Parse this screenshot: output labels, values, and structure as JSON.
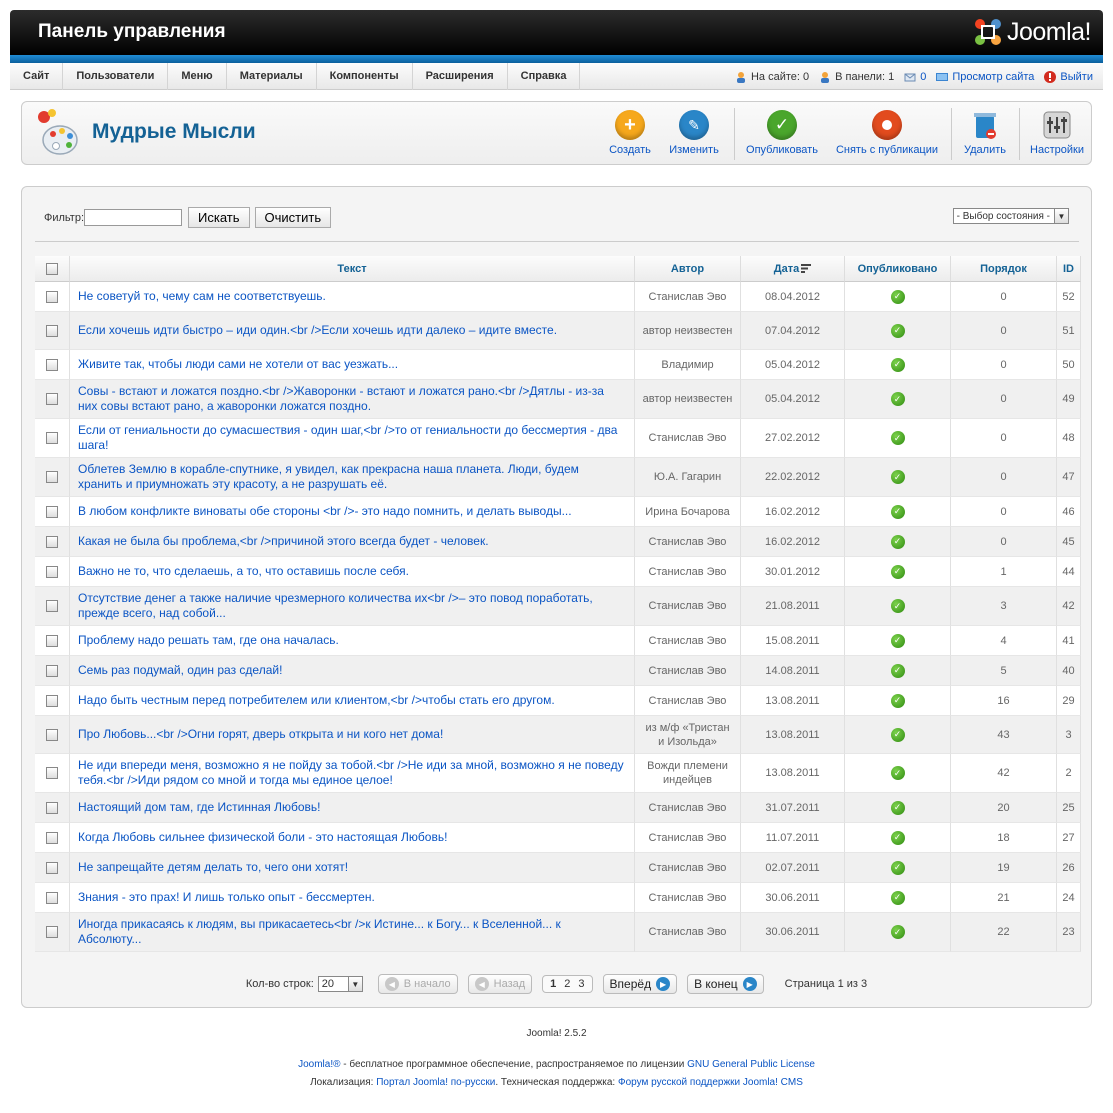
{
  "header": {
    "title": "Панель управления",
    "logo_text": "Joomla!"
  },
  "menu": [
    "Сайт",
    "Пользователи",
    "Меню",
    "Материалы",
    "Компоненты",
    "Расширения",
    "Справка"
  ],
  "status": {
    "on_site": "На сайте: 0",
    "in_panel": "В панели: 1",
    "messages": "0",
    "view_site": "Просмотр сайта",
    "logout": "Выйти"
  },
  "toolbar": {
    "title": "Мудрые Мысли",
    "buttons": {
      "create": "Создать",
      "edit": "Изменить",
      "publish": "Опубликовать",
      "unpublish": "Снять с публикации",
      "delete": "Удалить",
      "options": "Настройки"
    },
    "colors": {
      "create": "#f6a81c",
      "edit": "#2a86c8",
      "publish": "#4aa62c",
      "unpublish": "#e24b1e",
      "delete": "#2a86c8"
    }
  },
  "filter": {
    "label": "Фильтр:",
    "value": "",
    "search_btn": "Искать",
    "clear_btn": "Очистить",
    "state_select": "- Выбор состояния -"
  },
  "table": {
    "headers": {
      "text": "Текст",
      "author": "Автор",
      "date": "Дата",
      "published": "Опубликовано",
      "order": "Порядок",
      "id": "ID"
    },
    "rows": [
      {
        "text": "Не советуй то, чему сам не соответствуешь.",
        "author": "Станислав Эво",
        "date": "08.04.2012",
        "order": "0",
        "id": "52"
      },
      {
        "text": "Если хочешь идти быстро – иди один.<br />Если хочешь идти далеко – идите вместе.",
        "author": "автор неизвестен",
        "date": "07.04.2012",
        "order": "0",
        "id": "51"
      },
      {
        "text": "Живите так, чтобы люди сами не хотели от вас уезжать...",
        "author": "Владимир",
        "date": "05.04.2012",
        "order": "0",
        "id": "50"
      },
      {
        "text": "Совы - встают и ложатся поздно.<br />Жаворонки - встают и ложатся рано.<br />Дятлы - из-за них совы встают рано, а жаворонки ложатся поздно.",
        "author": "автор неизвестен",
        "date": "05.04.2012",
        "order": "0",
        "id": "49"
      },
      {
        "text": "Если от гениальности до сумасшествия - один шаг,<br />то от гениальности до бессмертия - два шага!",
        "author": "Станислав Эво",
        "date": "27.02.2012",
        "order": "0",
        "id": "48"
      },
      {
        "text": "Облетев Землю в корабле-спутнике, я увидел, как прекрасна наша планета. Люди, будем хранить и приумножать эту красоту, а не разрушать её.",
        "author": "Ю.А. Гагарин",
        "date": "22.02.2012",
        "order": "0",
        "id": "47"
      },
      {
        "text": "В любом конфликте виноваты обе стороны <br />- это надо помнить, и делать выводы...",
        "author": "Ирина Бочарова",
        "date": "16.02.2012",
        "order": "0",
        "id": "46"
      },
      {
        "text": "Какая не была бы проблема,<br />причиной этого всегда будет - человек.",
        "author": "Станислав Эво",
        "date": "16.02.2012",
        "order": "0",
        "id": "45"
      },
      {
        "text": "Важно не то, что сделаешь, а то, что оставишь после себя.",
        "author": "Станислав Эво",
        "date": "30.01.2012",
        "order": "1",
        "id": "44"
      },
      {
        "text": "Отсутствие денег а также наличие чрезмерного количества их<br />– это повод поработать, прежде всего, над собой...",
        "author": "Станислав Эво",
        "date": "21.08.2011",
        "order": "3",
        "id": "42"
      },
      {
        "text": "Проблему надо решать там, где она началась.",
        "author": "Станислав Эво",
        "date": "15.08.2011",
        "order": "4",
        "id": "41"
      },
      {
        "text": "Семь раз подумай, один раз сделай!",
        "author": "Станислав Эво",
        "date": "14.08.2011",
        "order": "5",
        "id": "40"
      },
      {
        "text": "Надо быть честным перед потребителем или клиентом,<br />чтобы стать его другом.",
        "author": "Станислав Эво",
        "date": "13.08.2011",
        "order": "16",
        "id": "29"
      },
      {
        "text": "Про Любовь...<br />Огни горят, дверь открыта и ни кого нет дома!",
        "author": "из м/ф «Тристан и Изольда»",
        "date": "13.08.2011",
        "order": "43",
        "id": "3"
      },
      {
        "text": "Не иди впереди меня, возможно я не пойду за тобой.<br />Не иди за мной, возможно я не поведу тебя.<br />Иди рядом со мной и тогда мы единое целое!",
        "author": "Вожди племени индейцев",
        "date": "13.08.2011",
        "order": "42",
        "id": "2"
      },
      {
        "text": "Настоящий дом там, где Истинная Любовь!",
        "author": "Станислав Эво",
        "date": "31.07.2011",
        "order": "20",
        "id": "25"
      },
      {
        "text": "Когда Любовь сильнее физической боли - это настоящая Любовь!",
        "author": "Станислав Эво",
        "date": "11.07.2011",
        "order": "18",
        "id": "27"
      },
      {
        "text": "Не запрещайте детям делать то, чего они хотят!",
        "author": "Станислав Эво",
        "date": "02.07.2011",
        "order": "19",
        "id": "26"
      },
      {
        "text": "Знания - это прах! И лишь только опыт - бессмертен.",
        "author": "Станислав Эво",
        "date": "30.06.2011",
        "order": "21",
        "id": "24"
      },
      {
        "text": "Иногда прикасаясь к людям, вы прикасаетесь<br />к Истине... к Богу... к Вселенной... к Абсолюту...",
        "author": "Станислав Эво",
        "date": "30.06.2011",
        "order": "22",
        "id": "23"
      }
    ]
  },
  "pagination": {
    "limit_label": "Кол-во строк:",
    "limit_value": "20",
    "start": "В начало",
    "prev": "Назад",
    "pages": [
      "1",
      "2",
      "3"
    ],
    "next": "Вперёд",
    "end": "В конец",
    "page_info": "Страница 1 из 3"
  },
  "footer": {
    "version": "Joomla! 2.5.2",
    "line1_link": "Joomla!®",
    "line1_text": " - бесплатное программное обеспечение, распространяемое по лицензии ",
    "line1_link2": "GNU General Public License",
    "line2_text": "Локализация: ",
    "line2_link": "Портал Joomla! по-русски",
    "line2_text2": ". Техническая поддержка: ",
    "line2_link2": "Форум русской поддержки Joomla! CMS"
  }
}
